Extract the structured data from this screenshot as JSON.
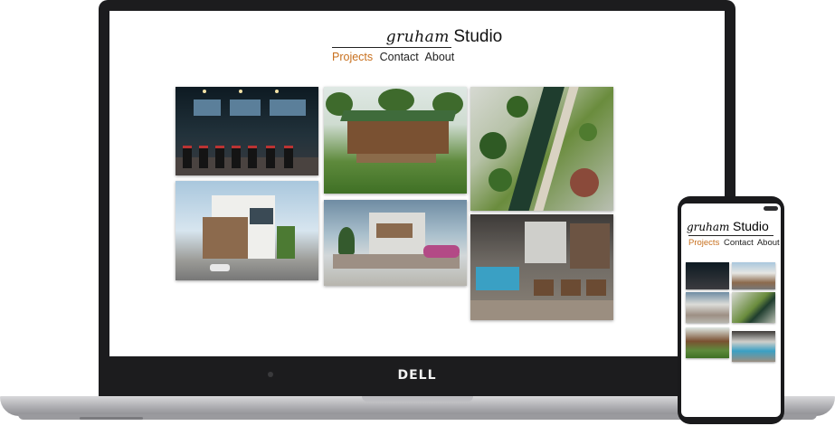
{
  "site": {
    "logo_script": "gruham",
    "logo_studio": "Studio",
    "nav": [
      "Projects",
      "Contact",
      "About"
    ],
    "active_nav": "Projects"
  },
  "device": {
    "brand": "DELL"
  },
  "gallery": [
    {
      "name": "gym-interior-thumbnail"
    },
    {
      "name": "pavilion-render-thumbnail"
    },
    {
      "name": "landscape-aerial-thumbnail"
    },
    {
      "name": "villa-render-thumbnail"
    },
    {
      "name": "villa-exterior-thumbnail"
    },
    {
      "name": "cafe-interior-thumbnail"
    }
  ],
  "colors": {
    "accent": "#c8701e",
    "text": "#222222",
    "bezel": "#1c1c1e"
  }
}
